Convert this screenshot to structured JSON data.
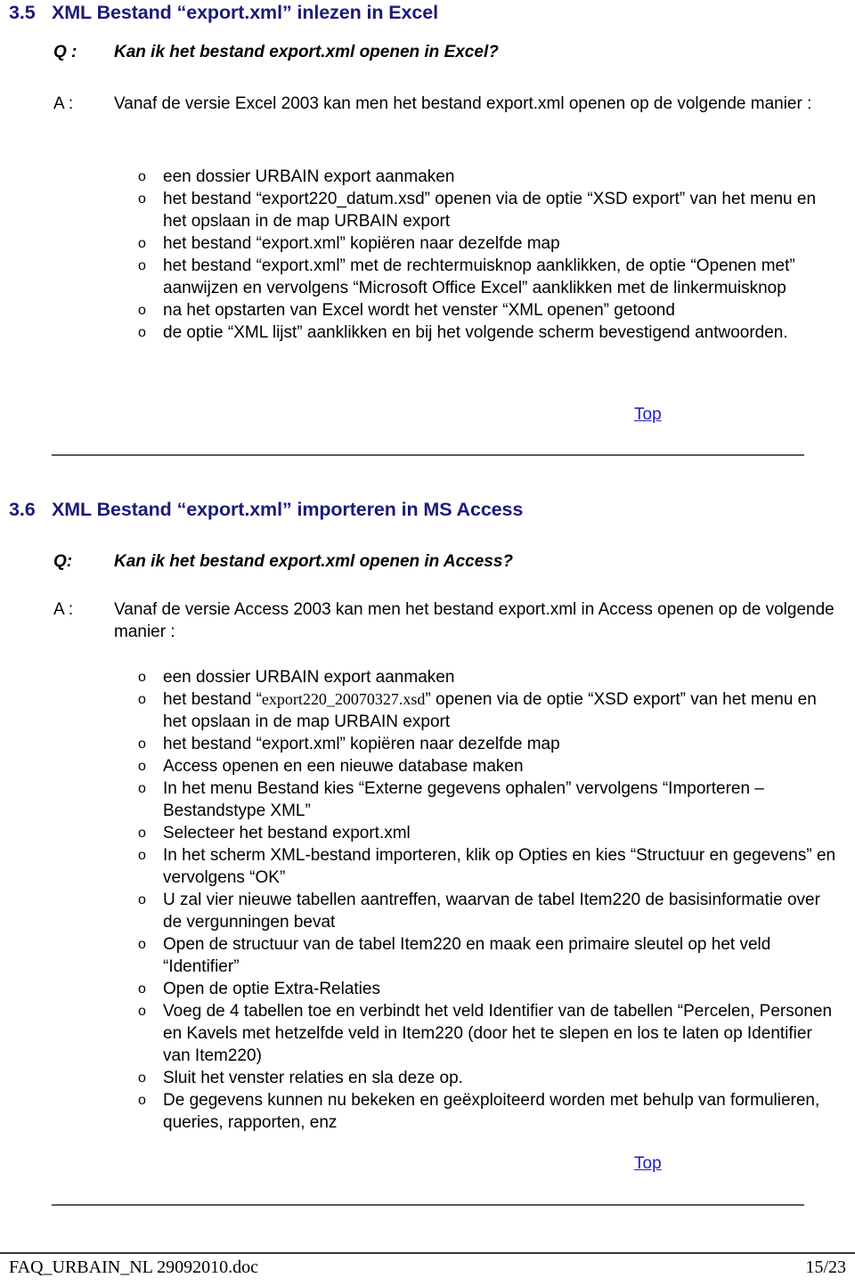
{
  "section_35": {
    "number": "3.5",
    "title": "XML Bestand “export.xml” inlezen in Excel",
    "q_label": "Q :",
    "q_text": "Kan ik het bestand  export.xml openen in Excel?",
    "a_label": "A :",
    "a_text": "Vanaf de versie Excel 2003 kan men het bestand export.xml openen op de volgende manier :",
    "bullets": [
      {
        "text": "een dossier URBAIN export aanmaken"
      },
      {
        "pre": "het bestand “export220_datum.xsd” openen via de optie “XSD export” van het menu en het opslaan in de map URBAIN export"
      },
      {
        "text": "het bestand “export.xml” kopiëren naar dezelfde map"
      },
      {
        "text": "het bestand “export.xml” met de rechtermuisknop aanklikken, de optie “Openen met” aanwijzen en vervolgens “Microsoft Office Excel” aanklikken met de linkermuisknop"
      },
      {
        "text": "na het opstarten van Excel wordt het venster “XML openen” getoond"
      },
      {
        "text": "de optie “XML lijst” aanklikken en bij het volgende scherm bevestigend antwoorden."
      }
    ],
    "bullet_marker": "o",
    "top_label": "Top"
  },
  "section_36": {
    "number": "3.6",
    "title": "XML Bestand “export.xml” importeren in MS Access",
    "q_label": "Q:",
    "q_text": "Kan ik het bestand  export.xml openen in Access?",
    "a_label": "A :",
    "a_text": "Vanaf de versie Access 2003 kan men het bestand export.xml in Access openen op de volgende manier :",
    "bullet_marker": "o",
    "bullets": [
      {
        "text": "een dossier URBAIN export aanmaken"
      },
      {
        "segments": [
          {
            "text": "het bestand “",
            "style": "sans"
          },
          {
            "text": "export220_20070327.xsd",
            "style": "serif"
          },
          {
            "text": "” openen via de optie “XSD export” van het menu en het opslaan in de map URBAIN export",
            "style": "sans"
          }
        ]
      },
      {
        "text": "het bestand “export.xml” kopiëren naar dezelfde map"
      },
      {
        "text": "Access openen en een nieuwe database maken"
      },
      {
        "text": "In het menu Bestand kies  “Externe gegevens ophalen” vervolgens  “Importeren – Bestandstype XML”"
      },
      {
        "text": "Selecteer het bestand export.xml"
      },
      {
        "text": "In het scherm XML-bestand importeren, klik op Opties en kies “Structuur en gegevens” en vervolgens “OK”"
      },
      {
        "text": "U zal vier nieuwe tabellen aantreffen, waarvan de tabel Item220 de basisinformatie over de vergunningen bevat"
      },
      {
        "text": "Open de structuur van de tabel Item220 en maak een primaire sleutel op het veld “Identifier”"
      },
      {
        "text": "Open de optie  Extra-Relaties"
      },
      {
        "text": "Voeg de 4 tabellen toe en verbindt het veld Identifier van de tabellen “Percelen, Personen en Kavels met hetzelfde veld in Item220 (door het te slepen en los te laten op Identifier van Item220)"
      },
      {
        "text": "Sluit het venster relaties en sla deze op."
      },
      {
        "text": "De gegevens kunnen nu bekeken en geëxploiteerd worden met behulp van formulieren, queries, rapporten, enz"
      }
    ],
    "top_label": "Top"
  },
  "footer": {
    "document_name": "FAQ_URBAIN_NL 29092010.doc",
    "page_number": "15/23"
  },
  "colors": {
    "heading": "#1b1b7a",
    "link": "#1c1cc8",
    "rule": "#5a5a5a",
    "text": "#000000"
  }
}
